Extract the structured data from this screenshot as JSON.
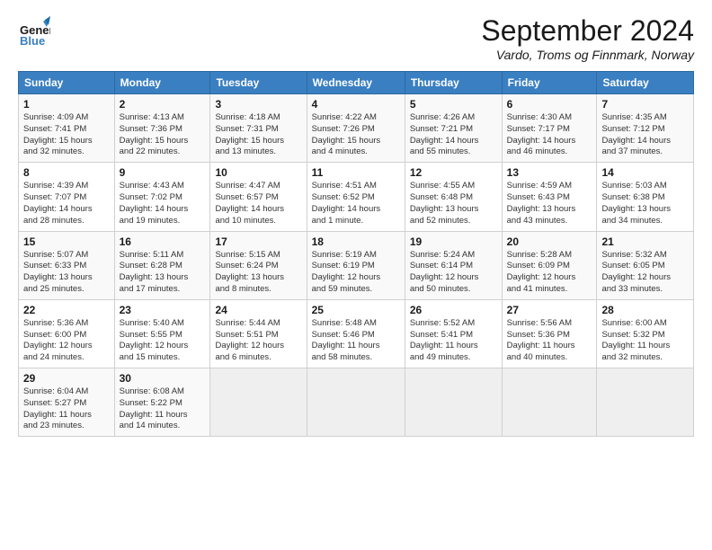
{
  "header": {
    "logo_general": "General",
    "logo_blue": "Blue",
    "month_title": "September 2024",
    "subtitle": "Vardo, Troms og Finnmark, Norway"
  },
  "days_of_week": [
    "Sunday",
    "Monday",
    "Tuesday",
    "Wednesday",
    "Thursday",
    "Friday",
    "Saturday"
  ],
  "weeks": [
    [
      {
        "day": "1",
        "info": "Sunrise: 4:09 AM\nSunset: 7:41 PM\nDaylight: 15 hours\nand 32 minutes."
      },
      {
        "day": "2",
        "info": "Sunrise: 4:13 AM\nSunset: 7:36 PM\nDaylight: 15 hours\nand 22 minutes."
      },
      {
        "day": "3",
        "info": "Sunrise: 4:18 AM\nSunset: 7:31 PM\nDaylight: 15 hours\nand 13 minutes."
      },
      {
        "day": "4",
        "info": "Sunrise: 4:22 AM\nSunset: 7:26 PM\nDaylight: 15 hours\nand 4 minutes."
      },
      {
        "day": "5",
        "info": "Sunrise: 4:26 AM\nSunset: 7:21 PM\nDaylight: 14 hours\nand 55 minutes."
      },
      {
        "day": "6",
        "info": "Sunrise: 4:30 AM\nSunset: 7:17 PM\nDaylight: 14 hours\nand 46 minutes."
      },
      {
        "day": "7",
        "info": "Sunrise: 4:35 AM\nSunset: 7:12 PM\nDaylight: 14 hours\nand 37 minutes."
      }
    ],
    [
      {
        "day": "8",
        "info": "Sunrise: 4:39 AM\nSunset: 7:07 PM\nDaylight: 14 hours\nand 28 minutes."
      },
      {
        "day": "9",
        "info": "Sunrise: 4:43 AM\nSunset: 7:02 PM\nDaylight: 14 hours\nand 19 minutes."
      },
      {
        "day": "10",
        "info": "Sunrise: 4:47 AM\nSunset: 6:57 PM\nDaylight: 14 hours\nand 10 minutes."
      },
      {
        "day": "11",
        "info": "Sunrise: 4:51 AM\nSunset: 6:52 PM\nDaylight: 14 hours\nand 1 minute."
      },
      {
        "day": "12",
        "info": "Sunrise: 4:55 AM\nSunset: 6:48 PM\nDaylight: 13 hours\nand 52 minutes."
      },
      {
        "day": "13",
        "info": "Sunrise: 4:59 AM\nSunset: 6:43 PM\nDaylight: 13 hours\nand 43 minutes."
      },
      {
        "day": "14",
        "info": "Sunrise: 5:03 AM\nSunset: 6:38 PM\nDaylight: 13 hours\nand 34 minutes."
      }
    ],
    [
      {
        "day": "15",
        "info": "Sunrise: 5:07 AM\nSunset: 6:33 PM\nDaylight: 13 hours\nand 25 minutes."
      },
      {
        "day": "16",
        "info": "Sunrise: 5:11 AM\nSunset: 6:28 PM\nDaylight: 13 hours\nand 17 minutes."
      },
      {
        "day": "17",
        "info": "Sunrise: 5:15 AM\nSunset: 6:24 PM\nDaylight: 13 hours\nand 8 minutes."
      },
      {
        "day": "18",
        "info": "Sunrise: 5:19 AM\nSunset: 6:19 PM\nDaylight: 12 hours\nand 59 minutes."
      },
      {
        "day": "19",
        "info": "Sunrise: 5:24 AM\nSunset: 6:14 PM\nDaylight: 12 hours\nand 50 minutes."
      },
      {
        "day": "20",
        "info": "Sunrise: 5:28 AM\nSunset: 6:09 PM\nDaylight: 12 hours\nand 41 minutes."
      },
      {
        "day": "21",
        "info": "Sunrise: 5:32 AM\nSunset: 6:05 PM\nDaylight: 12 hours\nand 33 minutes."
      }
    ],
    [
      {
        "day": "22",
        "info": "Sunrise: 5:36 AM\nSunset: 6:00 PM\nDaylight: 12 hours\nand 24 minutes."
      },
      {
        "day": "23",
        "info": "Sunrise: 5:40 AM\nSunset: 5:55 PM\nDaylight: 12 hours\nand 15 minutes."
      },
      {
        "day": "24",
        "info": "Sunrise: 5:44 AM\nSunset: 5:51 PM\nDaylight: 12 hours\nand 6 minutes."
      },
      {
        "day": "25",
        "info": "Sunrise: 5:48 AM\nSunset: 5:46 PM\nDaylight: 11 hours\nand 58 minutes."
      },
      {
        "day": "26",
        "info": "Sunrise: 5:52 AM\nSunset: 5:41 PM\nDaylight: 11 hours\nand 49 minutes."
      },
      {
        "day": "27",
        "info": "Sunrise: 5:56 AM\nSunset: 5:36 PM\nDaylight: 11 hours\nand 40 minutes."
      },
      {
        "day": "28",
        "info": "Sunrise: 6:00 AM\nSunset: 5:32 PM\nDaylight: 11 hours\nand 32 minutes."
      }
    ],
    [
      {
        "day": "29",
        "info": "Sunrise: 6:04 AM\nSunset: 5:27 PM\nDaylight: 11 hours\nand 23 minutes."
      },
      {
        "day": "30",
        "info": "Sunrise: 6:08 AM\nSunset: 5:22 PM\nDaylight: 11 hours\nand 14 minutes."
      },
      {
        "day": "",
        "info": ""
      },
      {
        "day": "",
        "info": ""
      },
      {
        "day": "",
        "info": ""
      },
      {
        "day": "",
        "info": ""
      },
      {
        "day": "",
        "info": ""
      }
    ]
  ]
}
